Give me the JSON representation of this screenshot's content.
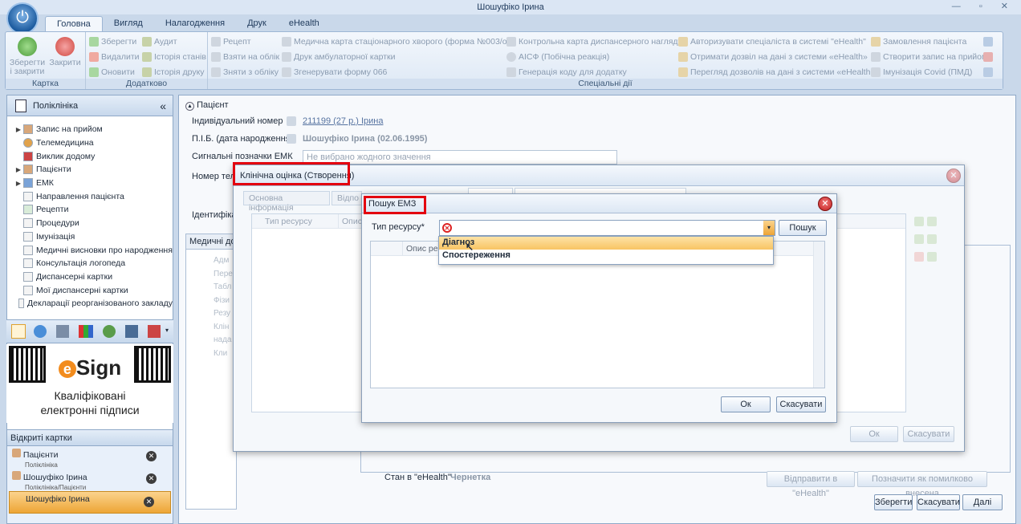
{
  "window": {
    "title": "Шошуфіко Ірина",
    "controls": "— ▫ ✕"
  },
  "ribbon": {
    "tabs": [
      "Головна",
      "Вигляд",
      "Налагодження",
      "Друк",
      "eHealth"
    ],
    "groups": {
      "card": {
        "label": "Картка",
        "save": "Зберегти і закрити",
        "close": "Закрити"
      },
      "extra": {
        "label": "Додатково",
        "items": [
          "Зберегти",
          "Аудит",
          "Видалити",
          "Історія станів",
          "Оновити",
          "Історія друку"
        ]
      },
      "special": {
        "label": "Спеціальні дії",
        "items": [
          "Рецепт",
          "Медична карта стаціонарного хворого (форма №003/о)",
          "Контрольна карта диспансерного нагляду",
          "Авторизувати спеціаліста в системі \"eHealth\"",
          "Замовлення пацієнта",
          "Взяти на облік",
          "Друк амбулаторної картки",
          "АІСФ (Побічна реакція)",
          "Отримати дозвіл на дані з системи «eHealth»",
          "Створити запис на прийом",
          "Зняти з обліку",
          "Згенерувати форму 066",
          "Генерація коду для додатку",
          "Перегляд дозволів на дані з системи «eHealth»",
          "Імунізація Covid (ПМД)"
        ]
      }
    }
  },
  "sidebar": {
    "title": "Поліклініка",
    "collapse": "«",
    "items": [
      {
        "label": "Запис на прийом",
        "expandable": true
      },
      {
        "label": "Телемедицина",
        "expandable": false
      },
      {
        "label": "Виклик додому",
        "expandable": false
      },
      {
        "label": "Пацієнти",
        "expandable": true
      },
      {
        "label": "ЕМК",
        "expandable": true
      },
      {
        "label": "Направлення пацієнта",
        "expandable": false
      },
      {
        "label": "Рецепти",
        "expandable": false
      },
      {
        "label": "Процедури",
        "expandable": false
      },
      {
        "label": "Імунізація",
        "expandable": false
      },
      {
        "label": "Медичні висновки про народження",
        "expandable": false
      },
      {
        "label": "Консультація логопеда",
        "expandable": false
      },
      {
        "label": "Диспансерні картки",
        "expandable": false
      },
      {
        "label": "Мої диспансерні картки",
        "expandable": false
      },
      {
        "label": "Декларації реорганізованого закладу",
        "expandable": false
      }
    ],
    "esign": {
      "brand_prefix": "e",
      "brand": "Sign",
      "line1": "Кваліфіковані",
      "line2": "електронні підписи"
    },
    "open_cards_title": "Відкриті картки",
    "open_cards": [
      {
        "title": "Пацієнти",
        "subtitle": "Поліклініка"
      },
      {
        "title": "Шошуфіко Ірина",
        "subtitle": "Поліклініка/Пацієнти"
      },
      {
        "title": "Шошуфіко Ірина",
        "subtitle": ""
      }
    ]
  },
  "patient": {
    "section": "Пацієнт",
    "id_label": "Індивідуальний номер",
    "id_value": "211199 (27 р.) Ірина",
    "name_label": "П.І.Б. (дата народження)",
    "name_value": "Шошуфіко Ірина (02.06.1995)",
    "signals_label": "Сигнальні позначки ЕМК",
    "signals_value": "Не вибрано жодного значення",
    "phone_label": "Номер теле",
    "ident_label": "Ідентифікат",
    "med_tab": "Медичні до",
    "tree_items": [
      "Адм",
      "Пере",
      "Табл",
      "Фізи",
      "Резу",
      "Клін",
      "нада",
      "Кли"
    ],
    "ehealth_status_label": "Стан в \"eHealth\"",
    "ehealth_status_value": "Чернетка",
    "send_btn": "Відправити в \"eHealth\"",
    "mark_error_btn": "Позначити як помилково внесена",
    "save_btn": "Зберегти",
    "cancel_btn": "Скасувати",
    "next_btn": "Далі"
  },
  "clinical_dialog": {
    "title": "Клінічна оцінка (Створення)",
    "tab_main": "Основна інформація",
    "tab_other": "Відпо",
    "col_type": "Тип ресурсу",
    "col_desc": "Опис",
    "ok": "Ок",
    "cancel": "Скасувати"
  },
  "search_dialog": {
    "title": "Пошук ЕМЗ",
    "type_label": "Тип ресурсу*",
    "search_btn": "Пошук",
    "col_desc": "Опис рес",
    "options": [
      "Діагноз",
      "Спостереження"
    ],
    "ok": "Ок",
    "cancel": "Скасувати"
  },
  "colors": {
    "highlight": "#e3000f",
    "selected_option": "#f8c463",
    "accent": "#1b5a9e"
  }
}
